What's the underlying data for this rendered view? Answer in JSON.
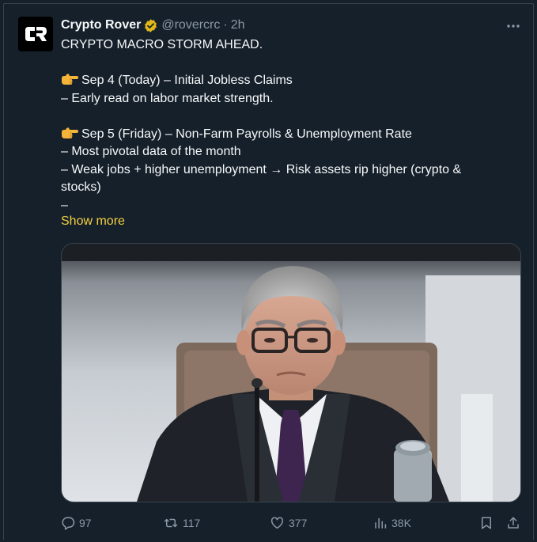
{
  "tweet": {
    "author": {
      "name": "Crypto Rover",
      "handle": "@rovercrc",
      "separator": "·",
      "time": "2h",
      "avatar_icon": "cr-logo-icon",
      "verified_icon": "verified-badge-icon"
    },
    "body": {
      "headline": "CRYPTO MACRO STORM AHEAD.",
      "block1": {
        "emoji_icon": "pointing-right-emoji",
        "title": "Sep 4 (Today) – Initial Jobless Claims",
        "lines": [
          "– Early read on labor market strength."
        ]
      },
      "block2": {
        "emoji_icon": "pointing-right-emoji",
        "title": "Sep 5 (Friday) – Non-Farm Payrolls & Unemployment Rate",
        "lines": [
          "– Most pivotal data of the month",
          "– Weak jobs + higher unemployment → Risk assets rip higher (crypto &",
          "stocks)",
          "–"
        ]
      }
    },
    "show_more_label": "Show more",
    "media": {
      "image_icon": "photo-of-man-in-suit-at-meeting"
    },
    "actions": {
      "reply": {
        "icon": "reply-icon",
        "count": "97"
      },
      "retweet": {
        "icon": "retweet-icon",
        "count": "117"
      },
      "like": {
        "icon": "heart-icon",
        "count": "377"
      },
      "views": {
        "icon": "views-chart-icon",
        "count": "38K"
      },
      "bookmark": {
        "icon": "bookmark-icon"
      },
      "share": {
        "icon": "share-icon"
      }
    },
    "colors": {
      "background": "#15202b",
      "text": "#f7f9f9",
      "muted": "#8b98a5",
      "link": "#f4d03f",
      "badge": "#e2b719",
      "border": "#38444d"
    }
  }
}
